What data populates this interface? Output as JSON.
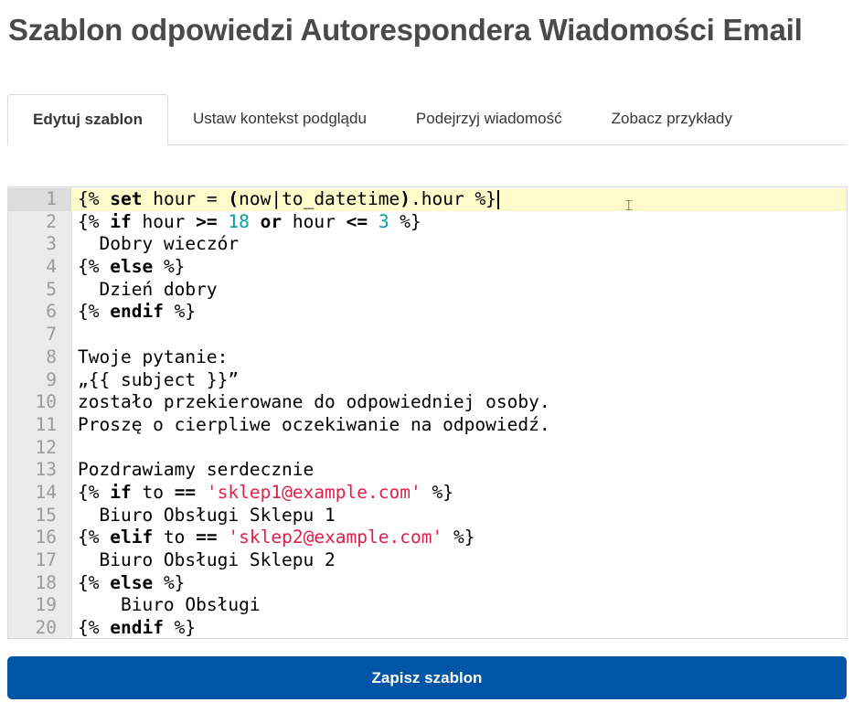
{
  "page": {
    "title": "Szablon odpowiedzi Autorespondera Wiadomości Email"
  },
  "tabs": [
    {
      "label": "Edytuj szablon",
      "active": true
    },
    {
      "label": "Ustaw kontekst podglądu",
      "active": false
    },
    {
      "label": "Podejrzyj wiadomość",
      "active": false
    },
    {
      "label": "Zobacz przykłady",
      "active": false
    }
  ],
  "editor": {
    "active_line": 1,
    "lines": [
      {
        "n": "1",
        "tokens": [
          [
            "t",
            "{% "
          ],
          [
            "kw",
            "set"
          ],
          [
            "t",
            " hour = "
          ],
          [
            "kw",
            "("
          ],
          [
            "t",
            "now|to_datetime"
          ],
          [
            "kw",
            ")"
          ],
          [
            "t",
            ".hour %}"
          ]
        ]
      },
      {
        "n": "2",
        "tokens": [
          [
            "t",
            "{% "
          ],
          [
            "kw",
            "if"
          ],
          [
            "t",
            " hour "
          ],
          [
            "kw",
            ">="
          ],
          [
            "t",
            " "
          ],
          [
            "num",
            "18"
          ],
          [
            "t",
            " "
          ],
          [
            "kw",
            "or"
          ],
          [
            "t",
            " hour "
          ],
          [
            "kw",
            "<="
          ],
          [
            "t",
            " "
          ],
          [
            "num",
            "3"
          ],
          [
            "t",
            " %}"
          ]
        ]
      },
      {
        "n": "3",
        "tokens": [
          [
            "t",
            "  Dobry wieczór"
          ]
        ]
      },
      {
        "n": "4",
        "tokens": [
          [
            "t",
            "{% "
          ],
          [
            "kw",
            "else"
          ],
          [
            "t",
            " %}"
          ]
        ]
      },
      {
        "n": "5",
        "tokens": [
          [
            "t",
            "  Dzień dobry"
          ]
        ]
      },
      {
        "n": "6",
        "tokens": [
          [
            "t",
            "{% "
          ],
          [
            "kw",
            "endif"
          ],
          [
            "t",
            " %}"
          ]
        ]
      },
      {
        "n": "7",
        "tokens": []
      },
      {
        "n": "8",
        "tokens": [
          [
            "t",
            "Twoje pytanie:"
          ]
        ]
      },
      {
        "n": "9",
        "tokens": [
          [
            "t",
            "„{{ subject }}”"
          ]
        ]
      },
      {
        "n": "10",
        "tokens": [
          [
            "t",
            "zostało przekierowane do odpowiedniej osoby."
          ]
        ]
      },
      {
        "n": "11",
        "tokens": [
          [
            "t",
            "Proszę o cierpliwe oczekiwanie na odpowiedź."
          ]
        ]
      },
      {
        "n": "12",
        "tokens": []
      },
      {
        "n": "13",
        "tokens": [
          [
            "t",
            "Pozdrawiamy serdecznie"
          ]
        ]
      },
      {
        "n": "14",
        "tokens": [
          [
            "t",
            "{% "
          ],
          [
            "kw",
            "if"
          ],
          [
            "t",
            " to "
          ],
          [
            "kw",
            "=="
          ],
          [
            "t",
            " "
          ],
          [
            "str",
            "'sklep1@example.com'"
          ],
          [
            "t",
            " %}"
          ]
        ]
      },
      {
        "n": "15",
        "tokens": [
          [
            "t",
            "  Biuro Obsługi Sklepu 1"
          ]
        ]
      },
      {
        "n": "16",
        "tokens": [
          [
            "t",
            "{% "
          ],
          [
            "kw",
            "elif"
          ],
          [
            "t",
            " to "
          ],
          [
            "kw",
            "=="
          ],
          [
            "t",
            " "
          ],
          [
            "str",
            "'sklep2@example.com'"
          ],
          [
            "t",
            " %}"
          ]
        ]
      },
      {
        "n": "17",
        "tokens": [
          [
            "t",
            "  Biuro Obsługi Sklepu 2"
          ]
        ]
      },
      {
        "n": "18",
        "tokens": [
          [
            "t",
            "{% "
          ],
          [
            "kw",
            "else"
          ],
          [
            "t",
            " %}"
          ]
        ]
      },
      {
        "n": "19",
        "tokens": [
          [
            "t",
            "    Biuro Obsługi"
          ]
        ]
      },
      {
        "n": "20",
        "tokens": [
          [
            "t",
            "{% "
          ],
          [
            "kw",
            "endif"
          ],
          [
            "t",
            " %}"
          ]
        ]
      }
    ]
  },
  "actions": {
    "save_label": "Zapisz szablon"
  },
  "colors": {
    "primary_button": "#0055a6",
    "active_line_bg": "#fdfbcb",
    "number_token": "#00a0a0",
    "string_token": "#e0204a"
  }
}
